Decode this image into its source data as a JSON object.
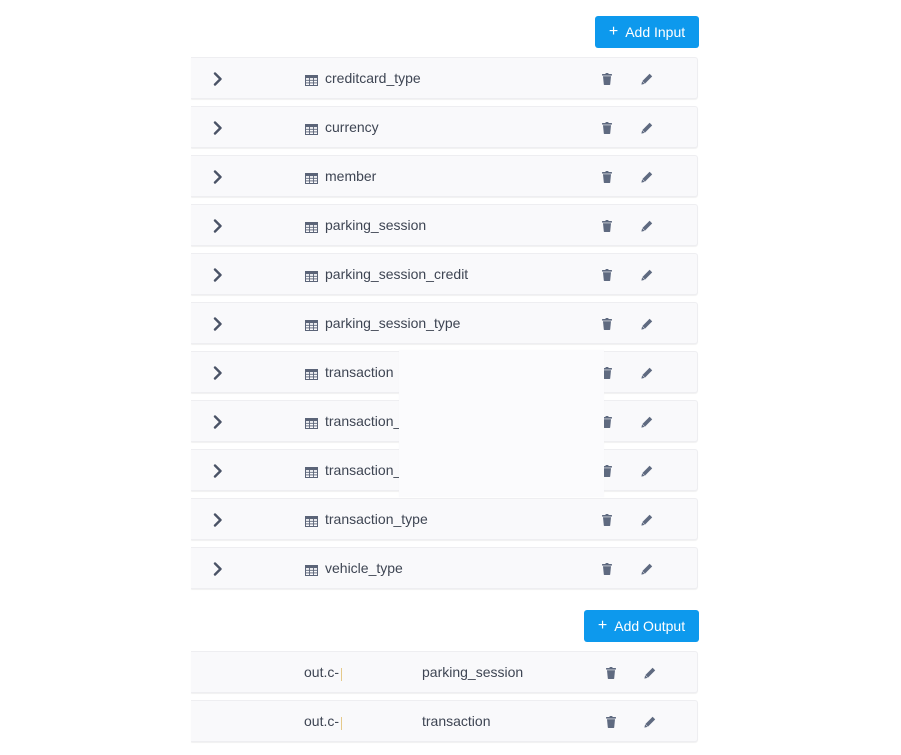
{
  "input_section": {
    "add_button": "Add Input",
    "tables": [
      {
        "name": "creditcard_type"
      },
      {
        "name": "currency"
      },
      {
        "name": "member"
      },
      {
        "name": "parking_session"
      },
      {
        "name": "parking_session_credit"
      },
      {
        "name": "parking_session_type"
      },
      {
        "name": "transaction"
      },
      {
        "name": "transaction_"
      },
      {
        "name": "transaction_"
      },
      {
        "name": "transaction_type"
      },
      {
        "name": "vehicle_type"
      }
    ]
  },
  "output_section": {
    "add_button": "Add Output",
    "mappings": [
      {
        "destination": "out.c-",
        "name": "parking_session"
      },
      {
        "destination": "out.c-",
        "name": "transaction"
      }
    ]
  },
  "icons": {
    "expand": "chevron-right-icon",
    "table": "table-icon",
    "delete": "trash-icon",
    "edit": "pencil-icon"
  },
  "colors": {
    "accent": "#0d99ed",
    "row_background": "#f9f9fb",
    "icon": "#5f6a80"
  }
}
